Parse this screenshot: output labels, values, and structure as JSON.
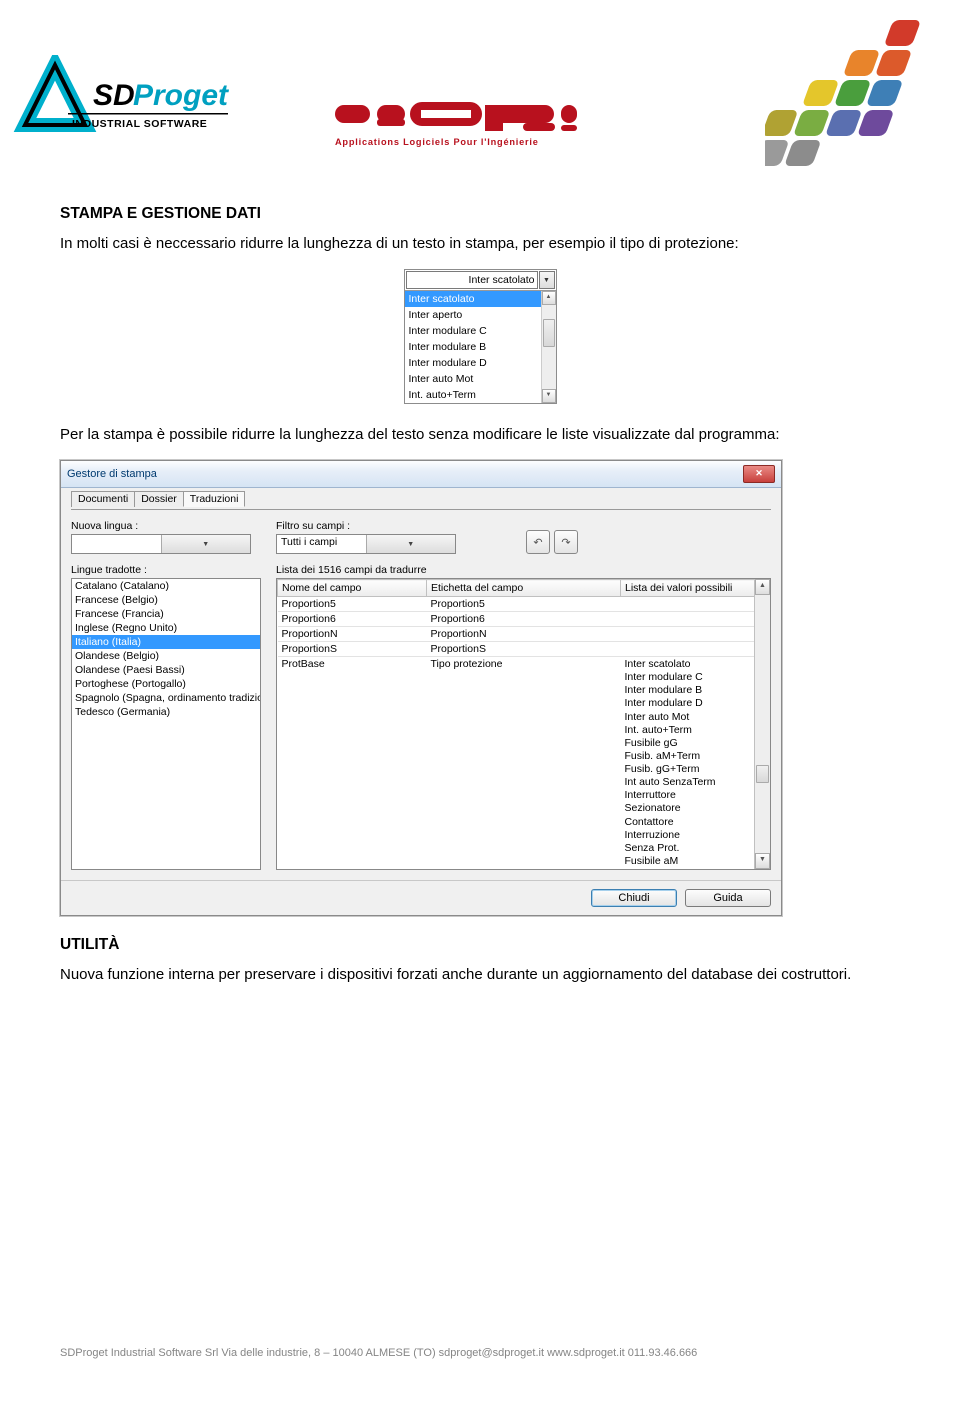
{
  "section1_title": "STAMPA E GESTIONE DATI",
  "para1": "In molti casi è neccessario ridurre la lunghezza di un testo in stampa, per esempio il tipo di protezione:",
  "dropdown": {
    "selected_text": "Inter scatolato",
    "items": [
      "Inter scatolato",
      "Inter aperto",
      "Inter modulare C",
      "Inter modulare B",
      "Inter modulare D",
      "Inter auto Mot",
      "Int. auto+Term"
    ]
  },
  "para2": "Per la stampa è possibile ridurre la lunghezza del testo senza modificare le liste visualizzate dal programma:",
  "window": {
    "title": "Gestore di stampa",
    "tabs": [
      "Documenti",
      "Dossier",
      "Traduzioni"
    ],
    "active_tab_index": 2,
    "labels": {
      "nuova_lingua": "Nuova lingua :",
      "filtro_campi": "Filtro su campi :",
      "filtro_value": "Tutti i campi",
      "lingue_tradotte": "Lingue tradotte :",
      "lista_count": "Lista dei 1516 campi da tradurre"
    },
    "languages": [
      "Catalano (Catalano)",
      "Francese (Belgio)",
      "Francese (Francia)",
      "Inglese (Regno Unito)",
      "Italiano (Italia)",
      "Olandese (Belgio)",
      "Olandese (Paesi Bassi)",
      "Portoghese (Portogallo)",
      "Spagnolo (Spagna, ordinamento tradizio",
      "Tedesco (Germania)"
    ],
    "selected_language_index": 4,
    "grid": {
      "headers": [
        "Nome del campo",
        "Etichetta del campo",
        "Lista dei valori possibili"
      ],
      "rows": [
        {
          "name": "Proportion5",
          "label": "Proportion5",
          "values": ""
        },
        {
          "name": "Proportion6",
          "label": "Proportion6",
          "values": ""
        },
        {
          "name": "ProportionN",
          "label": "ProportionN",
          "values": ""
        },
        {
          "name": "ProportionS",
          "label": "ProportionS",
          "values": ""
        },
        {
          "name": "ProtBase",
          "label": "Tipo protezione",
          "values": "Inter scatolato\nInter modulare C\nInter modulare B\nInter modulare D\nInter auto Mot\nInt. auto+Term\nFusibile gG\nFusib. aM+Term\nFusib. gG+Term\nInt auto SenzaTerm\nInterruttore\nSezionatore\nContattore\nInterruzione\nSenza Prot.\nFusibile aM"
        }
      ]
    },
    "buttons": {
      "close": "Chiudi",
      "help": "Guida"
    }
  },
  "section2_title": "UTILITÀ",
  "para3": "Nuova funzione interna per preservare i dispositivi forzati anche durante un aggiornamento del database dei costruttori.",
  "footer": "SDProget Industrial Software Srl Via delle industrie, 8 – 10040 ALMESE (TO) sdproget@sdproget.it www.sdproget.it 011.93.46.666",
  "logos": {
    "sdproget_text1": "SDProget",
    "sdproget_text2": "INDUSTRIAL SOFTWARE",
    "alpi_tag": "Applications Logiciels Pour l'Ingénierie"
  }
}
